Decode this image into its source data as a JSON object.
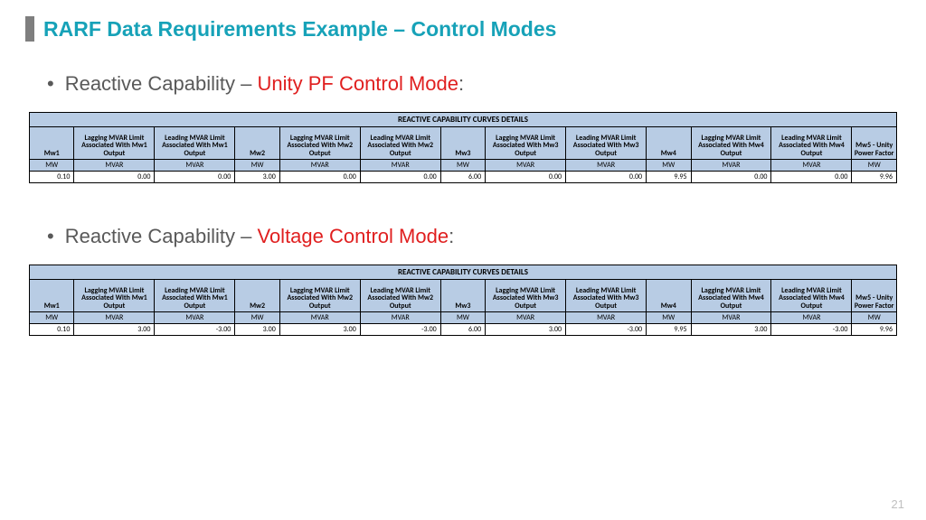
{
  "title": "RARF Data Requirements Example – Control Modes",
  "page_number": "21",
  "sections": [
    {
      "bullet_prefix": "Reactive Capability – ",
      "bullet_mode": "Unity PF Control Mode",
      "bullet_suffix": ":"
    },
    {
      "bullet_prefix": "Reactive Capability – ",
      "bullet_mode": "Voltage Control Mode",
      "bullet_suffix": ":"
    }
  ],
  "table_banner": "REACTIVE CAPABILITY CURVES DETAILS",
  "columns": [
    {
      "hdr": "Mw1",
      "unit": "MW",
      "cls": "mw"
    },
    {
      "hdr": "Lagging MVAR Limit Associated With Mw1 Output",
      "unit": "MVAR",
      "cls": "mvar"
    },
    {
      "hdr": "Leading MVAR Limit Associated With Mw1 Output",
      "unit": "MVAR",
      "cls": "mvar"
    },
    {
      "hdr": "Mw2",
      "unit": "MW",
      "cls": "mw"
    },
    {
      "hdr": "Lagging MVAR Limit Associated With Mw2 Output",
      "unit": "MVAR",
      "cls": "mvar"
    },
    {
      "hdr": "Leading MVAR Limit Associated With Mw2 Output",
      "unit": "MVAR",
      "cls": "mvar"
    },
    {
      "hdr": "Mw3",
      "unit": "MW",
      "cls": "mw"
    },
    {
      "hdr": "Lagging MVAR Limit Associated With Mw3 Output",
      "unit": "MVAR",
      "cls": "mvar"
    },
    {
      "hdr": "Leading MVAR Limit Associated With Mw3 Output",
      "unit": "MVAR",
      "cls": "mvar"
    },
    {
      "hdr": "Mw4",
      "unit": "MW",
      "cls": "mw"
    },
    {
      "hdr": "Lagging MVAR Limit Associated With Mw4 Output",
      "unit": "MVAR",
      "cls": "mvar"
    },
    {
      "hdr": "Leading MVAR Limit Associated With Mw4 Output",
      "unit": "MVAR",
      "cls": "mvar"
    },
    {
      "hdr": "Mw5 - Unity Power Factor",
      "unit": "MW",
      "cls": "last"
    }
  ],
  "tables": [
    {
      "values": [
        "0.10",
        "0.00",
        "0.00",
        "3.00",
        "0.00",
        "0.00",
        "6.00",
        "0.00",
        "0.00",
        "9.95",
        "0.00",
        "0.00",
        "9.96"
      ]
    },
    {
      "values": [
        "0.10",
        "3.00",
        "-3.00",
        "3.00",
        "3.00",
        "-3.00",
        "6.00",
        "3.00",
        "-3.00",
        "9.95",
        "3.00",
        "-3.00",
        "9.96"
      ]
    }
  ]
}
